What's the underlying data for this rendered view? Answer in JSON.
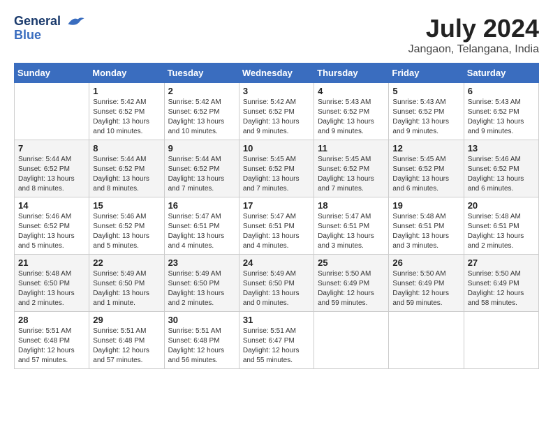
{
  "header": {
    "logo_line1": "General",
    "logo_line2": "Blue",
    "month_title": "July 2024",
    "location": "Jangaon, Telangana, India"
  },
  "days_of_week": [
    "Sunday",
    "Monday",
    "Tuesday",
    "Wednesday",
    "Thursday",
    "Friday",
    "Saturday"
  ],
  "weeks": [
    [
      {
        "day": "",
        "info": ""
      },
      {
        "day": "1",
        "info": "Sunrise: 5:42 AM\nSunset: 6:52 PM\nDaylight: 13 hours\nand 10 minutes."
      },
      {
        "day": "2",
        "info": "Sunrise: 5:42 AM\nSunset: 6:52 PM\nDaylight: 13 hours\nand 10 minutes."
      },
      {
        "day": "3",
        "info": "Sunrise: 5:42 AM\nSunset: 6:52 PM\nDaylight: 13 hours\nand 9 minutes."
      },
      {
        "day": "4",
        "info": "Sunrise: 5:43 AM\nSunset: 6:52 PM\nDaylight: 13 hours\nand 9 minutes."
      },
      {
        "day": "5",
        "info": "Sunrise: 5:43 AM\nSunset: 6:52 PM\nDaylight: 13 hours\nand 9 minutes."
      },
      {
        "day": "6",
        "info": "Sunrise: 5:43 AM\nSunset: 6:52 PM\nDaylight: 13 hours\nand 9 minutes."
      }
    ],
    [
      {
        "day": "7",
        "info": "Sunrise: 5:44 AM\nSunset: 6:52 PM\nDaylight: 13 hours\nand 8 minutes."
      },
      {
        "day": "8",
        "info": "Sunrise: 5:44 AM\nSunset: 6:52 PM\nDaylight: 13 hours\nand 8 minutes."
      },
      {
        "day": "9",
        "info": "Sunrise: 5:44 AM\nSunset: 6:52 PM\nDaylight: 13 hours\nand 7 minutes."
      },
      {
        "day": "10",
        "info": "Sunrise: 5:45 AM\nSunset: 6:52 PM\nDaylight: 13 hours\nand 7 minutes."
      },
      {
        "day": "11",
        "info": "Sunrise: 5:45 AM\nSunset: 6:52 PM\nDaylight: 13 hours\nand 7 minutes."
      },
      {
        "day": "12",
        "info": "Sunrise: 5:45 AM\nSunset: 6:52 PM\nDaylight: 13 hours\nand 6 minutes."
      },
      {
        "day": "13",
        "info": "Sunrise: 5:46 AM\nSunset: 6:52 PM\nDaylight: 13 hours\nand 6 minutes."
      }
    ],
    [
      {
        "day": "14",
        "info": "Sunrise: 5:46 AM\nSunset: 6:52 PM\nDaylight: 13 hours\nand 5 minutes."
      },
      {
        "day": "15",
        "info": "Sunrise: 5:46 AM\nSunset: 6:52 PM\nDaylight: 13 hours\nand 5 minutes."
      },
      {
        "day": "16",
        "info": "Sunrise: 5:47 AM\nSunset: 6:51 PM\nDaylight: 13 hours\nand 4 minutes."
      },
      {
        "day": "17",
        "info": "Sunrise: 5:47 AM\nSunset: 6:51 PM\nDaylight: 13 hours\nand 4 minutes."
      },
      {
        "day": "18",
        "info": "Sunrise: 5:47 AM\nSunset: 6:51 PM\nDaylight: 13 hours\nand 3 minutes."
      },
      {
        "day": "19",
        "info": "Sunrise: 5:48 AM\nSunset: 6:51 PM\nDaylight: 13 hours\nand 3 minutes."
      },
      {
        "day": "20",
        "info": "Sunrise: 5:48 AM\nSunset: 6:51 PM\nDaylight: 13 hours\nand 2 minutes."
      }
    ],
    [
      {
        "day": "21",
        "info": "Sunrise: 5:48 AM\nSunset: 6:50 PM\nDaylight: 13 hours\nand 2 minutes."
      },
      {
        "day": "22",
        "info": "Sunrise: 5:49 AM\nSunset: 6:50 PM\nDaylight: 13 hours\nand 1 minute."
      },
      {
        "day": "23",
        "info": "Sunrise: 5:49 AM\nSunset: 6:50 PM\nDaylight: 13 hours\nand 2 minutes."
      },
      {
        "day": "24",
        "info": "Sunrise: 5:49 AM\nSunset: 6:50 PM\nDaylight: 13 hours\nand 0 minutes."
      },
      {
        "day": "25",
        "info": "Sunrise: 5:50 AM\nSunset: 6:49 PM\nDaylight: 12 hours\nand 59 minutes."
      },
      {
        "day": "26",
        "info": "Sunrise: 5:50 AM\nSunset: 6:49 PM\nDaylight: 12 hours\nand 59 minutes."
      },
      {
        "day": "27",
        "info": "Sunrise: 5:50 AM\nSunset: 6:49 PM\nDaylight: 12 hours\nand 58 minutes."
      }
    ],
    [
      {
        "day": "28",
        "info": "Sunrise: 5:51 AM\nSunset: 6:48 PM\nDaylight: 12 hours\nand 57 minutes."
      },
      {
        "day": "29",
        "info": "Sunrise: 5:51 AM\nSunset: 6:48 PM\nDaylight: 12 hours\nand 57 minutes."
      },
      {
        "day": "30",
        "info": "Sunrise: 5:51 AM\nSunset: 6:48 PM\nDaylight: 12 hours\nand 56 minutes."
      },
      {
        "day": "31",
        "info": "Sunrise: 5:51 AM\nSunset: 6:47 PM\nDaylight: 12 hours\nand 55 minutes."
      },
      {
        "day": "",
        "info": ""
      },
      {
        "day": "",
        "info": ""
      },
      {
        "day": "",
        "info": ""
      }
    ]
  ]
}
